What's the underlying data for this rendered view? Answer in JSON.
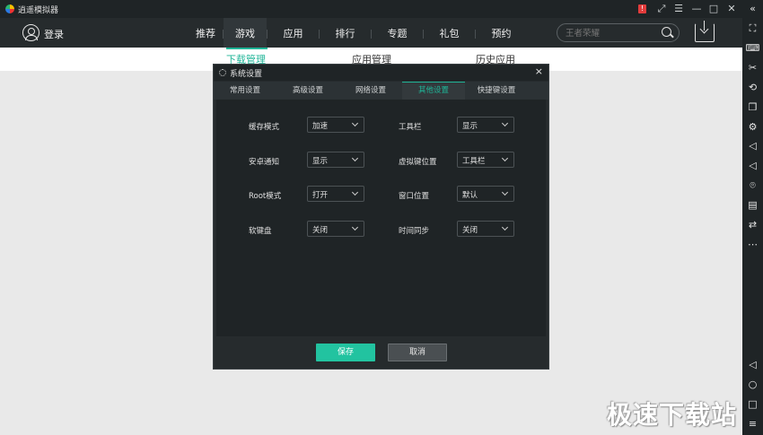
{
  "window": {
    "title": "逍遥模拟器",
    "controls": [
      "alert-icon",
      "fullscreen-icon",
      "menu-icon",
      "minimize-icon",
      "maximize-icon",
      "close-icon"
    ]
  },
  "header": {
    "login_label": "登录",
    "nav": [
      {
        "label": "推荐",
        "active": false
      },
      {
        "label": "游戏",
        "active": true
      },
      {
        "label": "应用",
        "active": false
      },
      {
        "label": "排行",
        "active": false
      },
      {
        "label": "专题",
        "active": false
      },
      {
        "label": "礼包",
        "active": false
      },
      {
        "label": "预约",
        "active": false
      }
    ],
    "search_placeholder": "王者荣耀"
  },
  "subtabs": [
    {
      "label": "下载管理",
      "active": true
    },
    {
      "label": "应用管理",
      "active": false
    },
    {
      "label": "历史应用",
      "active": false
    }
  ],
  "dialog": {
    "title": "系统设置",
    "tabs": [
      {
        "label": "常用设置",
        "active": false
      },
      {
        "label": "高级设置",
        "active": false
      },
      {
        "label": "网络设置",
        "active": false
      },
      {
        "label": "其他设置",
        "active": true
      },
      {
        "label": "快捷键设置",
        "active": false
      }
    ],
    "settings": [
      {
        "label": "缓存模式",
        "value": "加速"
      },
      {
        "label": "工具栏",
        "value": "显示"
      },
      {
        "label": "安卓通知",
        "value": "显示"
      },
      {
        "label": "虚拟键位置",
        "value": "工具栏"
      },
      {
        "label": "Root模式",
        "value": "打开"
      },
      {
        "label": "窗口位置",
        "value": "默认"
      },
      {
        "label": "软键盘",
        "value": "关闭"
      },
      {
        "label": "时间同步",
        "value": "关闭"
      }
    ],
    "save_label": "保存",
    "cancel_label": "取消"
  },
  "sidebar_icons": [
    "expand-icon",
    "keyboard-icon",
    "screenshot-icon",
    "rotate-icon",
    "multi-window-icon",
    "settings-icon",
    "volume-up-icon",
    "volume-down-icon",
    "location-icon",
    "file-icon",
    "sync-icon",
    "more-icon",
    "back-icon",
    "home-icon",
    "recent-apps-icon",
    "list-icon"
  ],
  "watermark": "极速下载站",
  "colors": {
    "accent": "#1fb597",
    "save": "#22c3a0",
    "panel": "#262b2d",
    "dark": "#1f2426"
  }
}
